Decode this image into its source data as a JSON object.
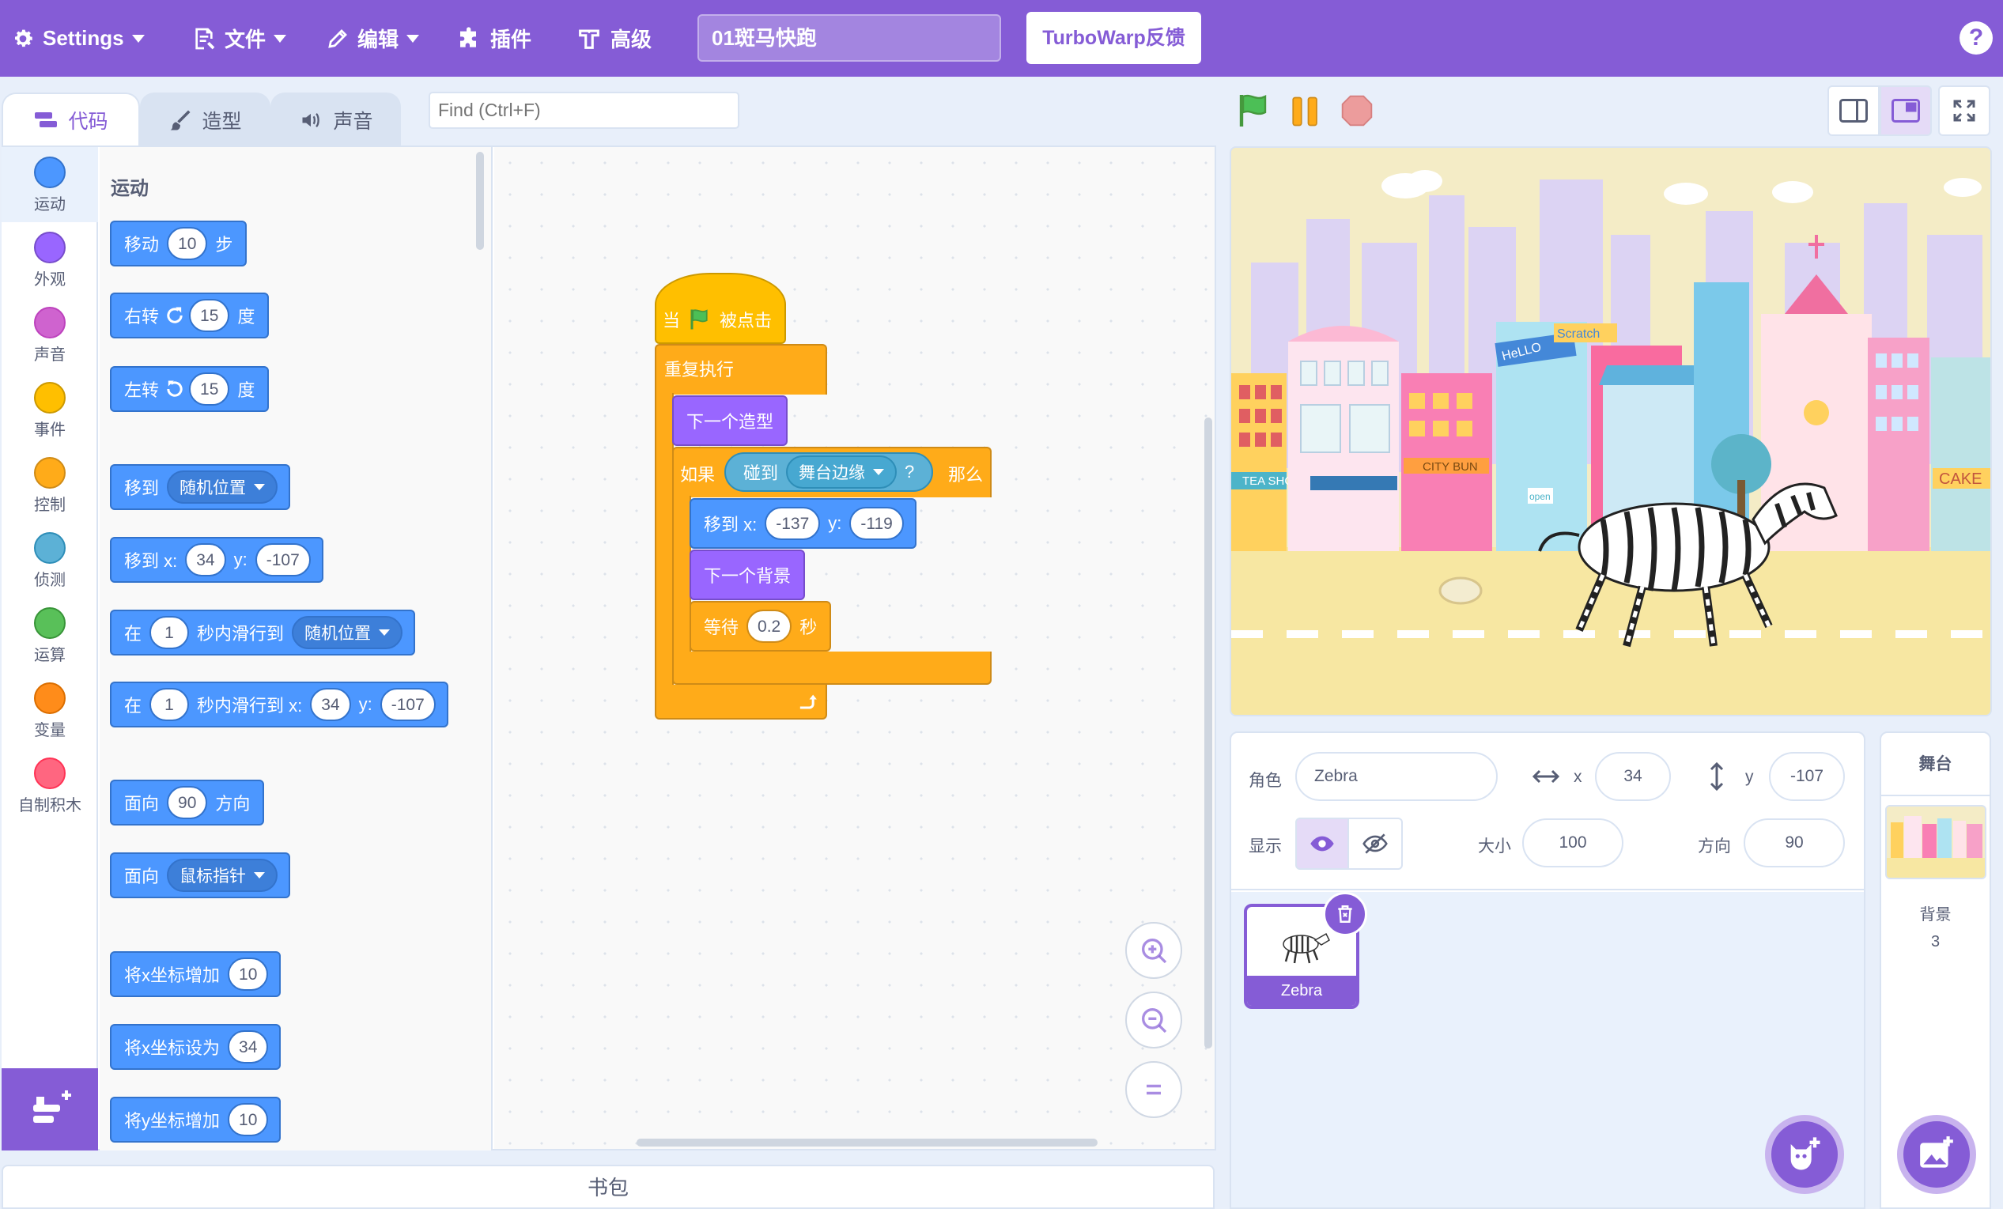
{
  "menubar": {
    "settings": "Settings",
    "file": "文件",
    "edit": "编辑",
    "addons": "插件",
    "advanced": "高级",
    "project_title": "01斑马快跑",
    "feedback": "TurboWarp反馈",
    "help": "?"
  },
  "tabs": {
    "code": "代码",
    "costumes": "造型",
    "sounds": "声音"
  },
  "find": {
    "placeholder": "Find (Ctrl+F)"
  },
  "categories": [
    {
      "label": "运动",
      "color": "#4c97ff"
    },
    {
      "label": "外观",
      "color": "#9966ff"
    },
    {
      "label": "声音",
      "color": "#cf63cf"
    },
    {
      "label": "事件",
      "color": "#ffbf00"
    },
    {
      "label": "控制",
      "color": "#ffab19"
    },
    {
      "label": "侦测",
      "color": "#5cb1d6"
    },
    {
      "label": "运算",
      "color": "#59c059"
    },
    {
      "label": "变量",
      "color": "#ff8c1a"
    },
    {
      "label": "自制积木",
      "color": "#ff6680"
    }
  ],
  "palette": {
    "heading": "运动",
    "move": {
      "a": "移动",
      "v": "10",
      "b": "步"
    },
    "turn_right": {
      "a": "右转",
      "v": "15",
      "b": "度"
    },
    "turn_left": {
      "a": "左转",
      "v": "15",
      "b": "度"
    },
    "goto": {
      "a": "移到",
      "opt": "随机位置"
    },
    "goto_xy": {
      "a": "移到 x:",
      "x": "34",
      "b": "y:",
      "y": "-107"
    },
    "glide": {
      "a": "在",
      "v": "1",
      "b": "秒内滑行到",
      "opt": "随机位置"
    },
    "glide_xy": {
      "a": "在",
      "v": "1",
      "b": "秒内滑行到 x:",
      "x": "34",
      "c": "y:",
      "y": "-107"
    },
    "point_dir": {
      "a": "面向",
      "v": "90",
      "b": "方向"
    },
    "point_towards": {
      "a": "面向",
      "opt": "鼠标指针"
    },
    "change_x": {
      "a": "将x坐标增加",
      "v": "10"
    },
    "set_x": {
      "a": "将x坐标设为",
      "v": "34"
    },
    "change_y": {
      "a": "将y坐标增加",
      "v": "10"
    }
  },
  "script": {
    "hat_a": "当",
    "hat_b": "被点击",
    "forever": "重复执行",
    "next_costume": "下一个造型",
    "if": "如果",
    "touching": "碰到",
    "touching_opt": "舞台边缘",
    "question": "?",
    "then": "那么",
    "goto_a": "移到 x:",
    "goto_x": "-137",
    "goto_b": "y:",
    "goto_y": "-119",
    "next_backdrop": "下一个背景",
    "wait_a": "等待",
    "wait_v": "0.2",
    "wait_b": "秒"
  },
  "backpack": "书包",
  "sprite_info": {
    "sprite_label": "角色",
    "sprite_name": "Zebra",
    "x_label": "x",
    "x": "34",
    "y_label": "y",
    "y": "-107",
    "show_label": "显示",
    "size_label": "大小",
    "size": "100",
    "direction_label": "方向",
    "direction": "90"
  },
  "sprites": [
    {
      "name": "Zebra"
    }
  ],
  "stage_pane": {
    "title": "舞台",
    "backdrops_label": "背景",
    "backdrops_count": "3"
  },
  "stage_scene": {
    "tea_shop": "TEA SHOP",
    "city_bun": "CITY BUN",
    "cake": "CAKE",
    "hello": "HeLLO",
    "scratch": "Scratch",
    "open": "open"
  },
  "colors": {
    "brand": "#855cd6",
    "motion": "#4c97ff",
    "looks": "#9966ff",
    "control": "#ffab19",
    "events": "#ffbf00",
    "sensing": "#5cb1d6"
  }
}
